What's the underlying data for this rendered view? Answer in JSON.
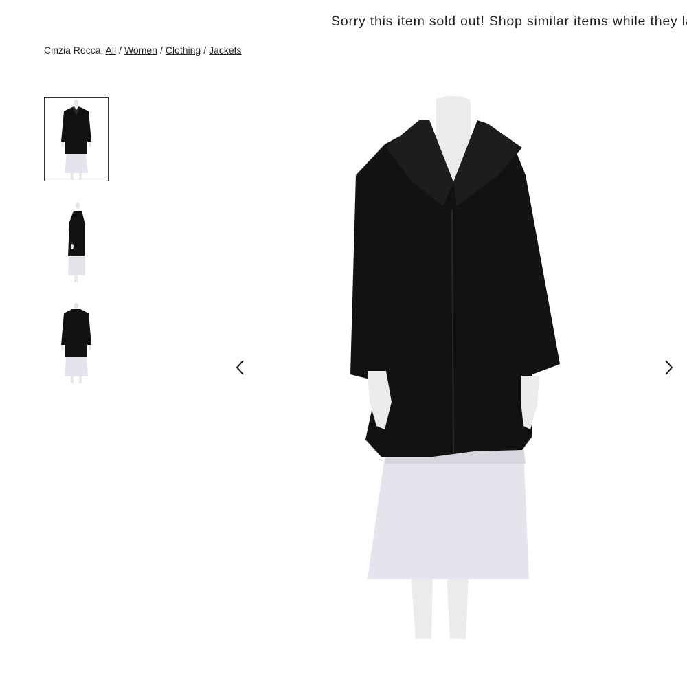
{
  "banner": {
    "text": "Sorry this item sold out! Shop similar items while they last."
  },
  "breadcrumb": {
    "brand": "Cinzia Rocca:",
    "links": [
      "All",
      "Women",
      "Clothing",
      "Jackets"
    ],
    "separator": "/"
  },
  "gallery": {
    "thumbnails": [
      {
        "view": "front",
        "selected": true
      },
      {
        "view": "side",
        "selected": false
      },
      {
        "view": "back",
        "selected": false
      }
    ],
    "prev_icon": "chevron-left-icon",
    "next_icon": "chevron-right-icon"
  },
  "colors": {
    "coat": "#121212",
    "skirt": "#e6e3ec",
    "mannequin": "#ebebeb"
  }
}
